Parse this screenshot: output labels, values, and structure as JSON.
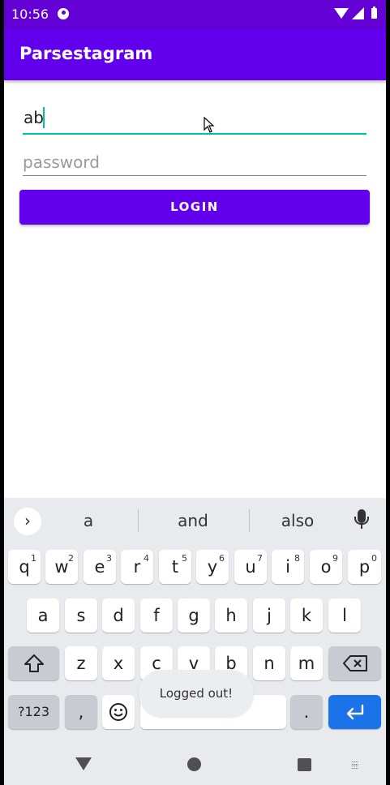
{
  "status_bar": {
    "time": "10:56"
  },
  "app_bar": {
    "title": "Parsestagram"
  },
  "form": {
    "username_value": "ab",
    "password_placeholder": "password",
    "login_label": "LOGIN"
  },
  "keyboard": {
    "suggestions": [
      "a",
      "and",
      "also"
    ],
    "row1": [
      {
        "k": "q",
        "s": "1"
      },
      {
        "k": "w",
        "s": "2"
      },
      {
        "k": "e",
        "s": "3"
      },
      {
        "k": "r",
        "s": "4"
      },
      {
        "k": "t",
        "s": "5"
      },
      {
        "k": "y",
        "s": "6"
      },
      {
        "k": "u",
        "s": "7"
      },
      {
        "k": "i",
        "s": "8"
      },
      {
        "k": "o",
        "s": "9"
      },
      {
        "k": "p",
        "s": "0"
      }
    ],
    "row2": [
      "a",
      "s",
      "d",
      "f",
      "g",
      "h",
      "j",
      "k",
      "l"
    ],
    "row3": [
      "z",
      "x",
      "c",
      "v",
      "b",
      "n",
      "m"
    ],
    "symbols_label": "?123",
    "comma": ",",
    "period": "."
  },
  "toast": {
    "text": "Logged out!"
  },
  "colors": {
    "primary": "#6200ee",
    "status_bar": "#6200d6",
    "accent": "#00bfa5",
    "enter_key": "#1a73e8"
  }
}
